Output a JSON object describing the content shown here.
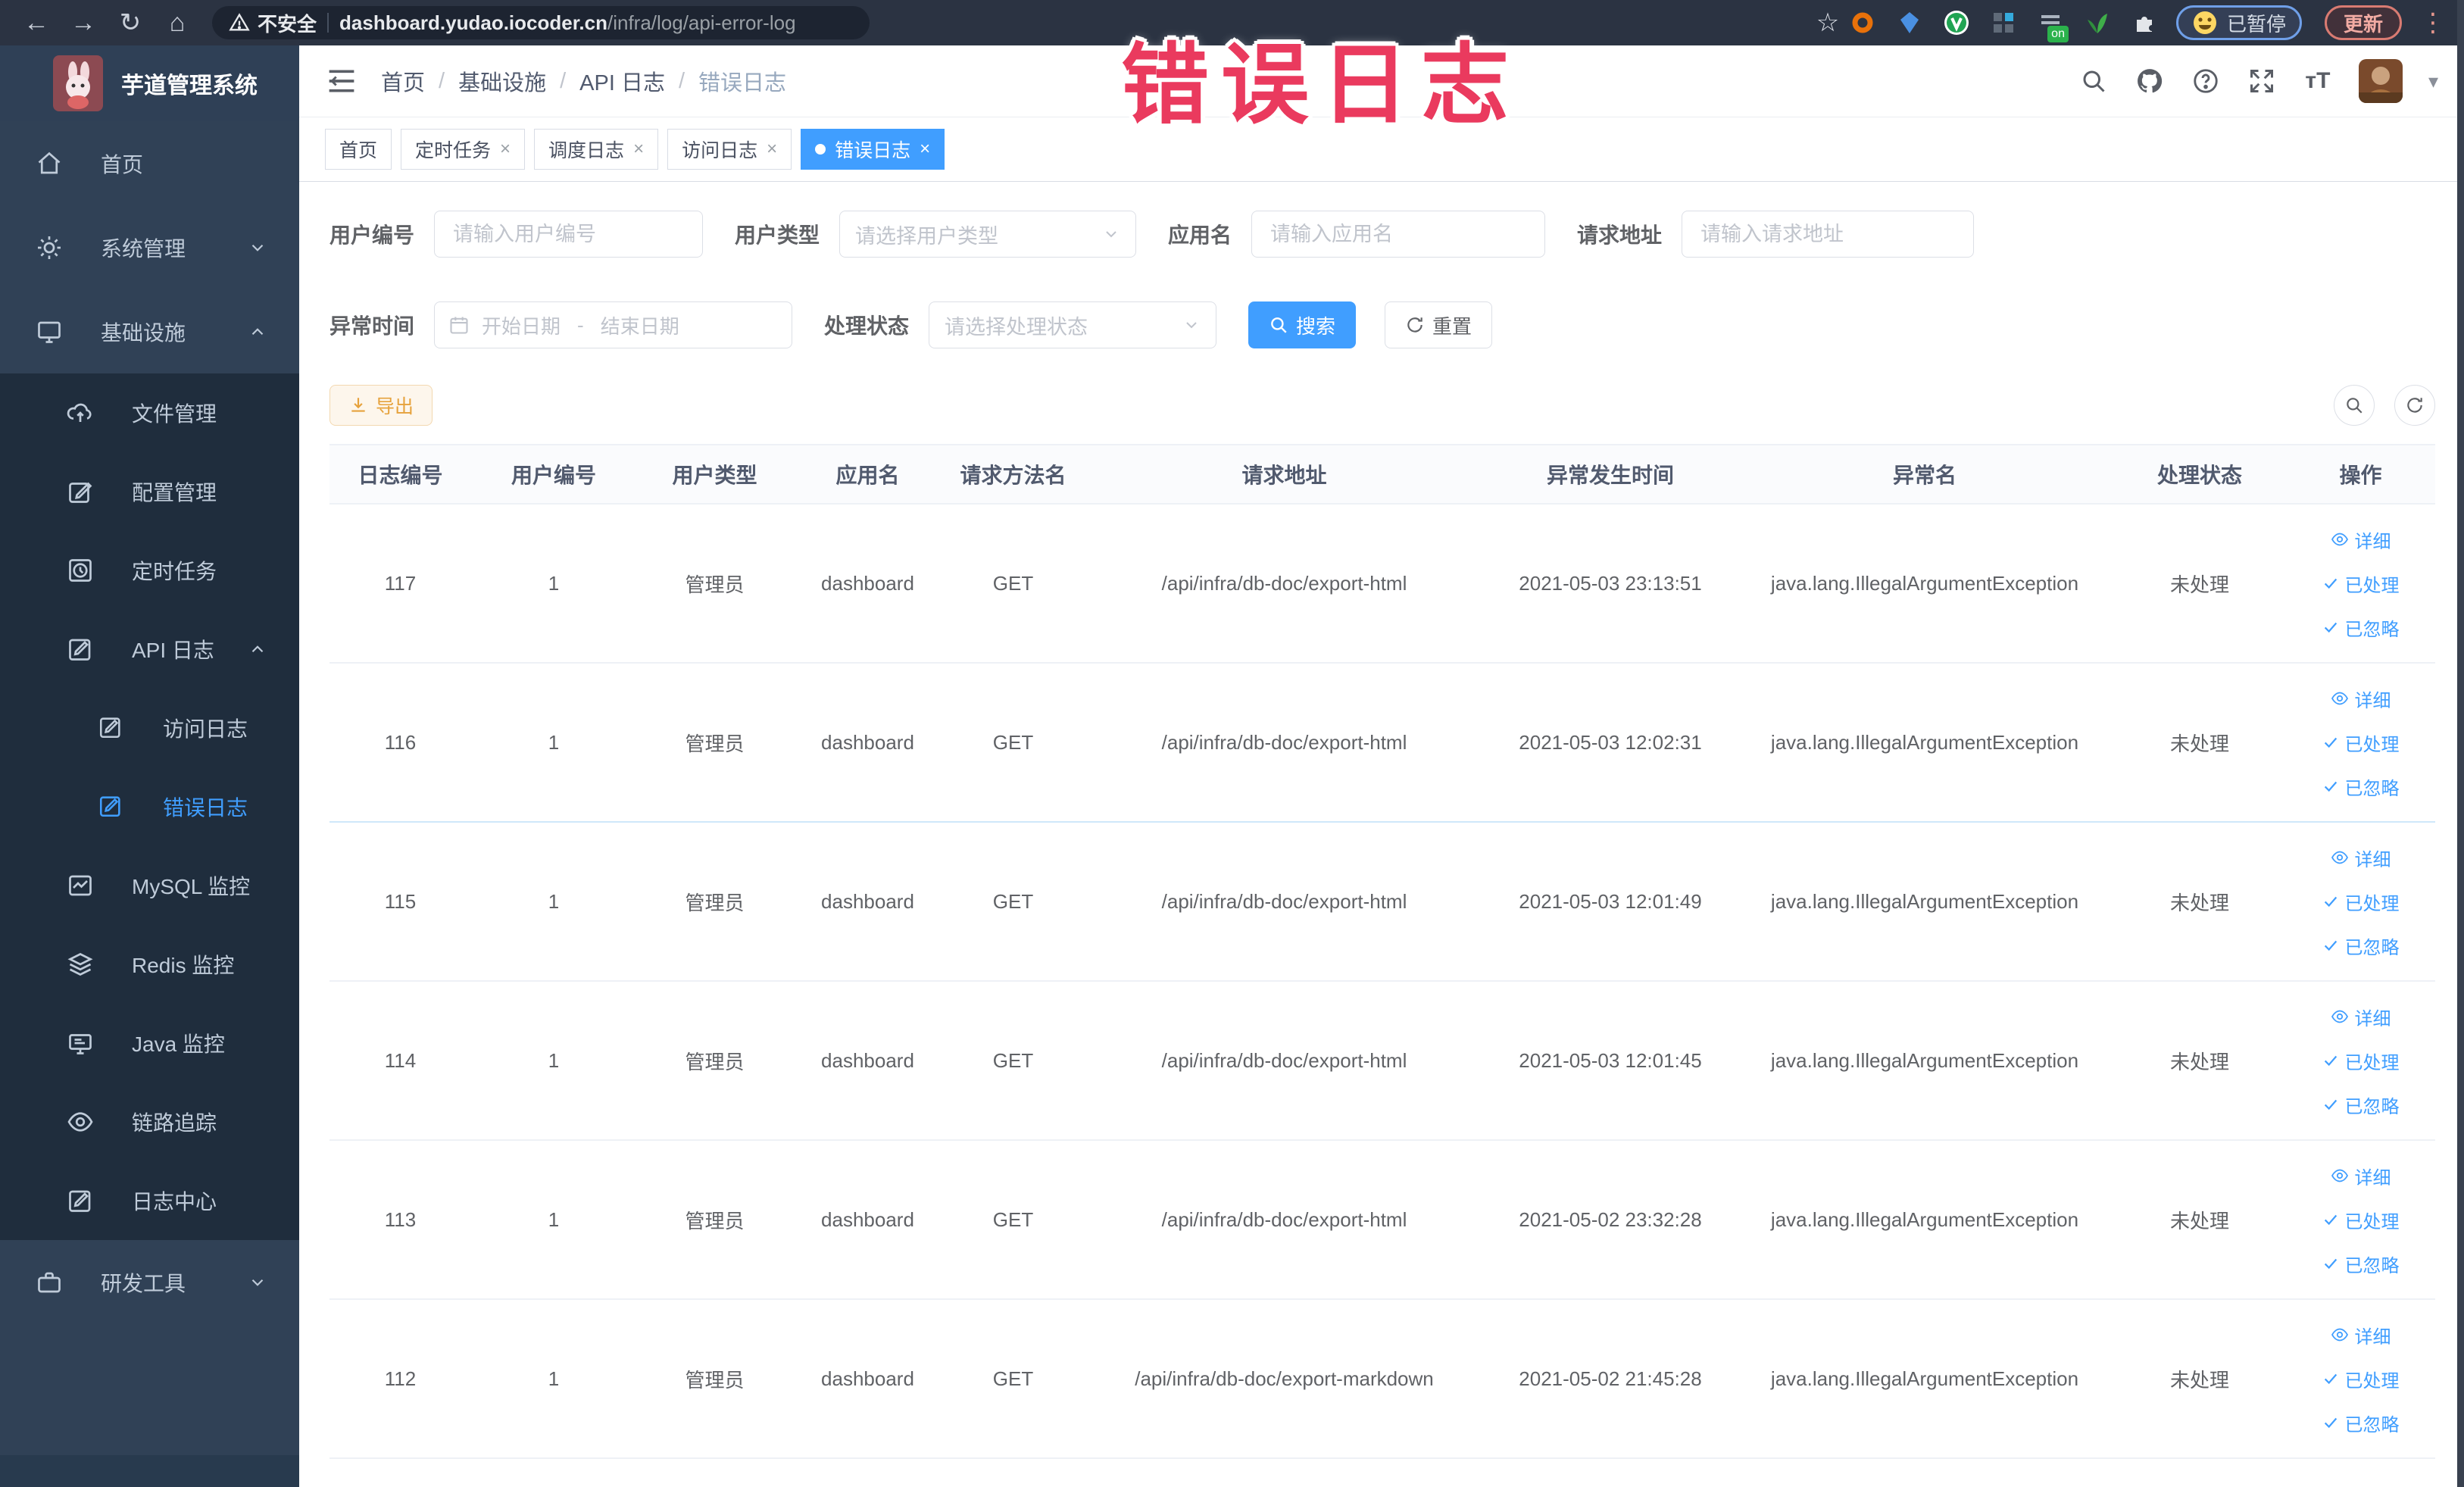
{
  "browser": {
    "security_label": "不安全",
    "url_host": "dashboard.yudao.iocoder.cn",
    "url_path": "/infra/log/api-error-log",
    "paused_badge": "已暂停",
    "update_button": "更新",
    "extension_on_badge": "on",
    "icons": {
      "back": "←",
      "forward": "→",
      "reload": "↻",
      "home": "⌂",
      "star": "☆",
      "more": "⋮",
      "caret_down": "▾"
    }
  },
  "overlay_title": "错误日志",
  "sidebar": {
    "logo_title": "芋道管理系统",
    "home": {
      "label": "首页"
    },
    "system": {
      "label": "系统管理"
    },
    "infra": {
      "label": "基础设施"
    },
    "file": {
      "label": "文件管理"
    },
    "config": {
      "label": "配置管理"
    },
    "job": {
      "label": "定时任务"
    },
    "apilog": {
      "label": "API 日志"
    },
    "accesslog": {
      "label": "访问日志"
    },
    "errorlog": {
      "label": "错误日志"
    },
    "mysql": {
      "label": "MySQL 监控"
    },
    "redis": {
      "label": "Redis 监控"
    },
    "java": {
      "label": "Java 监控"
    },
    "trace": {
      "label": "链路追踪"
    },
    "logcenter": {
      "label": "日志中心"
    },
    "devtools": {
      "label": "研发工具"
    }
  },
  "header": {
    "breadcrumb": {
      "0": "首页",
      "1": "基础设施",
      "2": "API 日志",
      "3": "错误日志"
    },
    "separator": "/"
  },
  "tabs": {
    "t0": "首页",
    "t1": "定时任务",
    "t2": "调度日志",
    "t3": "访问日志",
    "t4": "错误日志",
    "close": "×"
  },
  "filters": {
    "user_id": {
      "label": "用户编号",
      "placeholder": "请输入用户编号"
    },
    "user_type": {
      "label": "用户类型",
      "placeholder": "请选择用户类型"
    },
    "app_name": {
      "label": "应用名",
      "placeholder": "请输入应用名"
    },
    "request_url": {
      "label": "请求地址",
      "placeholder": "请输入请求地址"
    },
    "exception_time": {
      "label": "异常时间",
      "start_placeholder": "开始日期",
      "separator": "-",
      "end_placeholder": "结束日期"
    },
    "process_status": {
      "label": "处理状态",
      "placeholder": "请选择处理状态"
    },
    "search_button": "搜索",
    "reset_button": "重置"
  },
  "toolbar": {
    "export_button": "导出"
  },
  "table": {
    "headers": {
      "0": "日志编号",
      "1": "用户编号",
      "2": "用户类型",
      "3": "应用名",
      "4": "请求方法名",
      "5": "请求地址",
      "6": "异常发生时间",
      "7": "异常名",
      "8": "处理状态",
      "9": "操作"
    },
    "actions": {
      "detail": "详细",
      "processed": "已处理",
      "ignored": "已忽略"
    },
    "rows": [
      {
        "id": "117",
        "user_id": "1",
        "user_type": "管理员",
        "app": "dashboard",
        "method": "GET",
        "url": "/api/infra/db-doc/export-html",
        "time": "2021-05-03 23:13:51",
        "exception": "java.lang.IllegalArgumentException",
        "status": "未处理"
      },
      {
        "id": "116",
        "user_id": "1",
        "user_type": "管理员",
        "app": "dashboard",
        "method": "GET",
        "url": "/api/infra/db-doc/export-html",
        "time": "2021-05-03 12:02:31",
        "exception": "java.lang.IllegalArgumentException",
        "status": "未处理"
      },
      {
        "id": "115",
        "user_id": "1",
        "user_type": "管理员",
        "app": "dashboard",
        "method": "GET",
        "url": "/api/infra/db-doc/export-html",
        "time": "2021-05-03 12:01:49",
        "exception": "java.lang.IllegalArgumentException",
        "status": "未处理"
      },
      {
        "id": "114",
        "user_id": "1",
        "user_type": "管理员",
        "app": "dashboard",
        "method": "GET",
        "url": "/api/infra/db-doc/export-html",
        "time": "2021-05-03 12:01:45",
        "exception": "java.lang.IllegalArgumentException",
        "status": "未处理"
      },
      {
        "id": "113",
        "user_id": "1",
        "user_type": "管理员",
        "app": "dashboard",
        "method": "GET",
        "url": "/api/infra/db-doc/export-html",
        "time": "2021-05-02 23:32:28",
        "exception": "java.lang.IllegalArgumentException",
        "status": "未处理"
      },
      {
        "id": "112",
        "user_id": "1",
        "user_type": "管理员",
        "app": "dashboard",
        "method": "GET",
        "url": "/api/infra/db-doc/export-markdown",
        "time": "2021-05-02 21:45:28",
        "exception": "java.lang.IllegalArgumentException",
        "status": "未处理"
      }
    ]
  },
  "colors": {
    "primary": "#409eff",
    "warning_text": "#e6a23c",
    "sidebar_bg": "#304156",
    "submenu_bg": "#1f2d3d",
    "overlay_red": "#ea3a5e"
  }
}
